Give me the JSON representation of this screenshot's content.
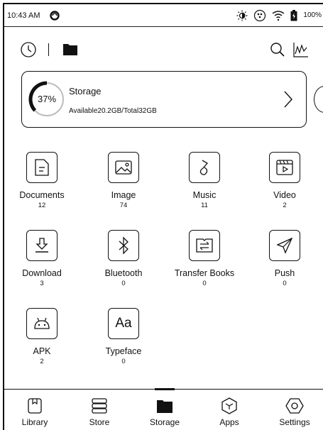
{
  "status_bar": {
    "time": "10:43 AM",
    "battery": "100%",
    "icons": [
      "sync-icon",
      "brightness-icon",
      "light-icon",
      "wifi-icon",
      "battery-icon"
    ]
  },
  "toolbar": {
    "icons": [
      "history-icon",
      "folder-icon",
      "search-icon",
      "statistics-icon"
    ]
  },
  "storage": {
    "percent_label": "37%",
    "percent_used": 0.37,
    "title": "Storage",
    "info": "Available20.2GB/Total32GB"
  },
  "categories": [
    {
      "label": "Documents",
      "count": "12",
      "icon": "document-icon"
    },
    {
      "label": "Image",
      "count": "74",
      "icon": "image-icon"
    },
    {
      "label": "Music",
      "count": "11",
      "icon": "music-icon"
    },
    {
      "label": "Video",
      "count": "2",
      "icon": "video-icon"
    },
    {
      "label": "Download",
      "count": "3",
      "icon": "download-icon"
    },
    {
      "label": "Bluetooth",
      "count": "0",
      "icon": "bluetooth-icon"
    },
    {
      "label": "Transfer Books",
      "count": "0",
      "icon": "transfer-books-icon"
    },
    {
      "label": "Push",
      "count": "0",
      "icon": "push-icon"
    },
    {
      "label": "APK",
      "count": "2",
      "icon": "android-icon"
    },
    {
      "label": "Typeface",
      "count": "0",
      "icon": "typeface-icon"
    }
  ],
  "typeface_glyph": "Aa",
  "bottom_nav": [
    {
      "label": "Library",
      "icon": "library-icon"
    },
    {
      "label": "Store",
      "icon": "store-icon"
    },
    {
      "label": "Storage",
      "icon": "storage-folder-icon",
      "active": true
    },
    {
      "label": "Apps",
      "icon": "apps-icon"
    },
    {
      "label": "Settings",
      "icon": "settings-icon"
    }
  ]
}
